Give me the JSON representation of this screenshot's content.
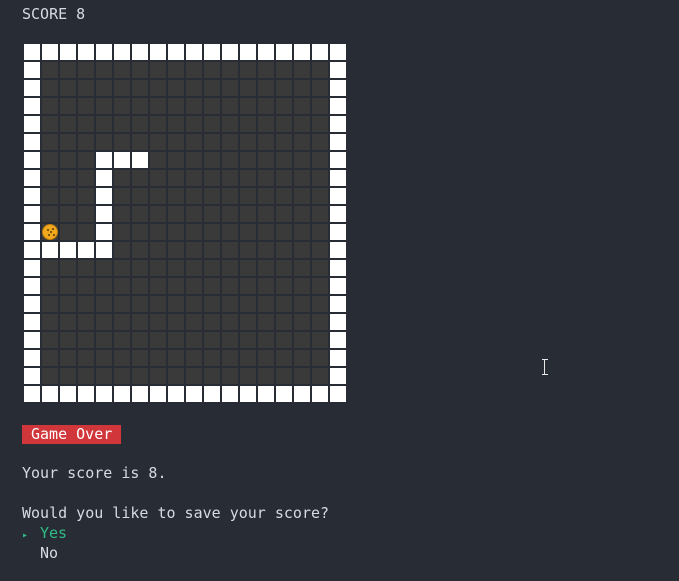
{
  "header": {
    "score_text": "SCORE 8"
  },
  "game": {
    "columns": 18,
    "rows": 20,
    "snake": [
      [
        5,
        6
      ],
      [
        6,
        6
      ],
      [
        4,
        6
      ],
      [
        4,
        7
      ],
      [
        4,
        8
      ],
      [
        4,
        9
      ],
      [
        4,
        10
      ],
      [
        4,
        11
      ],
      [
        3,
        11
      ],
      [
        2,
        11
      ],
      [
        1,
        11
      ]
    ],
    "food": [
      1,
      10
    ],
    "colors": {
      "background": "#272c35",
      "wall": "#ffffff",
      "snake": "#ffffff",
      "empty": "#3a3a3a",
      "food": "#f0a81e"
    }
  },
  "status": {
    "badge": "Game Over"
  },
  "result": {
    "score_line": "Your score is 8."
  },
  "prompt": {
    "question": "Would you like to save your score?",
    "options": [
      {
        "label": "Yes",
        "selected": true
      },
      {
        "label": "No",
        "selected": false
      }
    ],
    "pointer_icon": "triangle-right"
  }
}
